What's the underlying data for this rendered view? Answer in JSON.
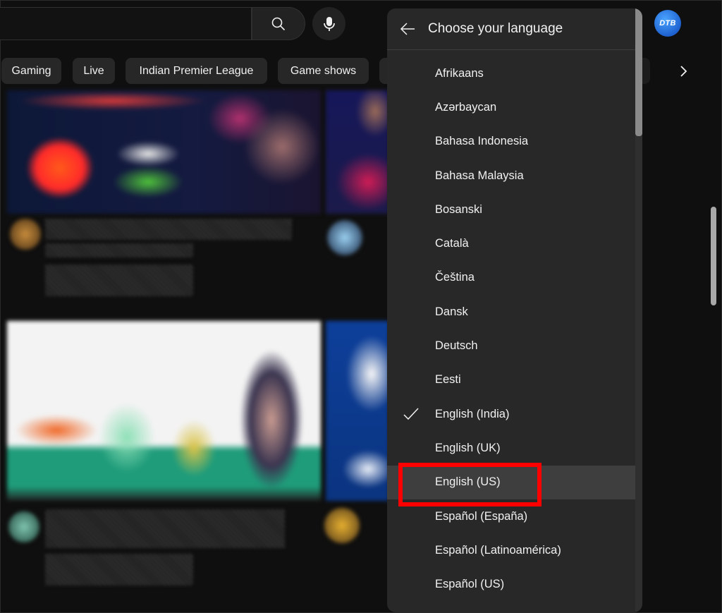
{
  "search": {
    "placeholder": "",
    "search_icon": "search-icon",
    "mic_icon": "microphone-icon"
  },
  "account": {
    "avatar_text": "DTB"
  },
  "chips": [
    {
      "label": "Gaming"
    },
    {
      "label": "Live"
    },
    {
      "label": "Indian Premier League"
    },
    {
      "label": "Game shows"
    }
  ],
  "chips_next_icon": "chevron-right-icon",
  "language_menu": {
    "title": "Choose your language",
    "back_icon": "arrow-left-icon",
    "selected": "English (India)",
    "hovered": "English (US)",
    "items": [
      {
        "label": "Afrikaans"
      },
      {
        "label": "Azərbaycan"
      },
      {
        "label": "Bahasa Indonesia"
      },
      {
        "label": "Bahasa Malaysia"
      },
      {
        "label": "Bosanski"
      },
      {
        "label": "Català"
      },
      {
        "label": "Čeština"
      },
      {
        "label": "Dansk"
      },
      {
        "label": "Deutsch"
      },
      {
        "label": "Eesti"
      },
      {
        "label": "English (India)"
      },
      {
        "label": "English (UK)"
      },
      {
        "label": "English (US)"
      },
      {
        "label": "Español (España)"
      },
      {
        "label": "Español (Latinoamérica)"
      },
      {
        "label": "Español (US)"
      }
    ]
  },
  "annotation": {
    "color": "#ff0000",
    "target": "English (US)"
  }
}
